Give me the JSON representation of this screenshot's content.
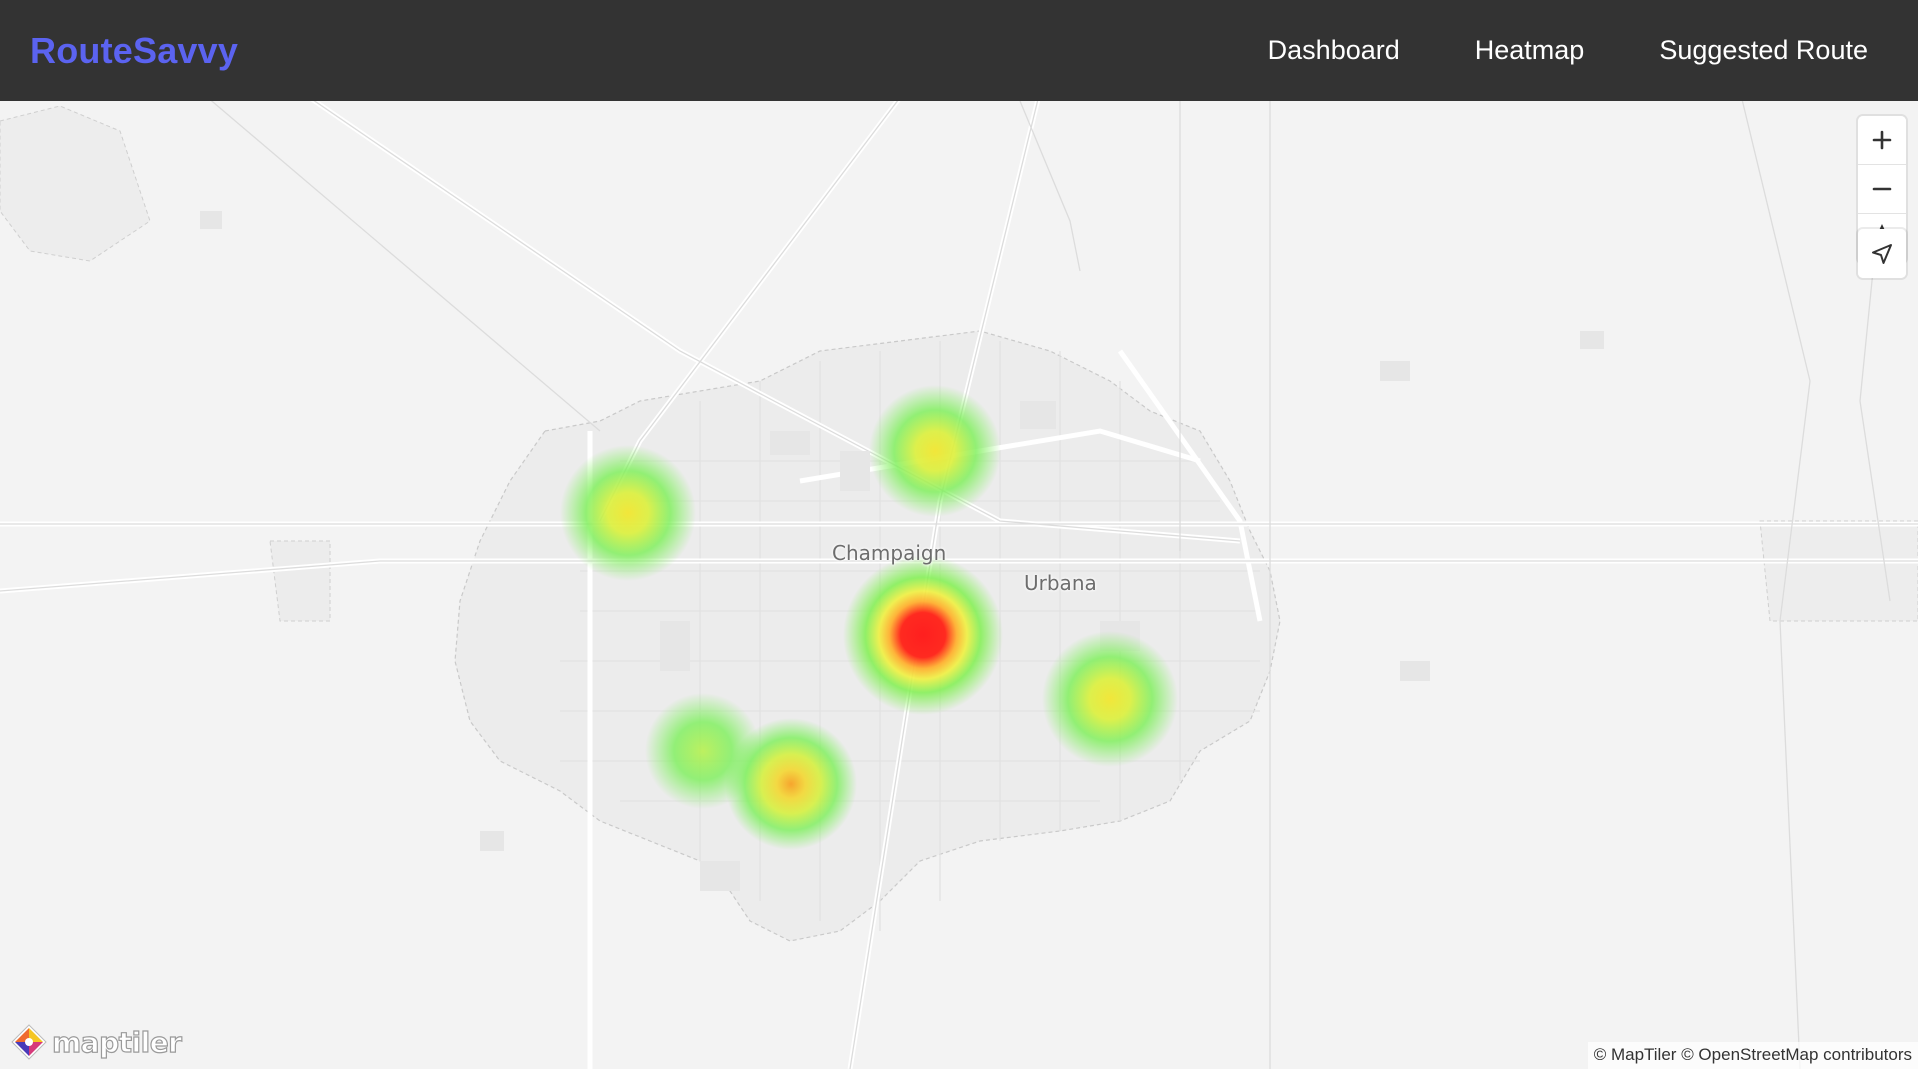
{
  "header": {
    "brand": "RouteSavvy",
    "nav": [
      {
        "label": "Dashboard"
      },
      {
        "label": "Heatmap"
      },
      {
        "label": "Suggested Route"
      }
    ]
  },
  "map": {
    "labels": {
      "champaign": "Champaign",
      "urbana": "Urbana"
    },
    "controls": {
      "zoom_in_icon": "plus-icon",
      "zoom_out_icon": "minus-icon",
      "compass_icon": "compass-icon",
      "locate_icon": "navigation-arrow-icon"
    },
    "logo": "maptiler",
    "attribution": {
      "maptiler": "© MapTiler",
      "osm": "© OpenStreetMap contributors"
    },
    "heatmap_colors": {
      "low": "#7cf05a",
      "mid": "#f5f03c",
      "high": "#ff2020"
    },
    "hotspots": [
      {
        "name": "west",
        "intensity": 0.55
      },
      {
        "name": "north",
        "intensity": 0.55
      },
      {
        "name": "downtown",
        "intensity": 1.0
      },
      {
        "name": "east",
        "intensity": 0.6
      },
      {
        "name": "southwest",
        "intensity": 0.35
      },
      {
        "name": "south",
        "intensity": 0.7
      }
    ]
  }
}
